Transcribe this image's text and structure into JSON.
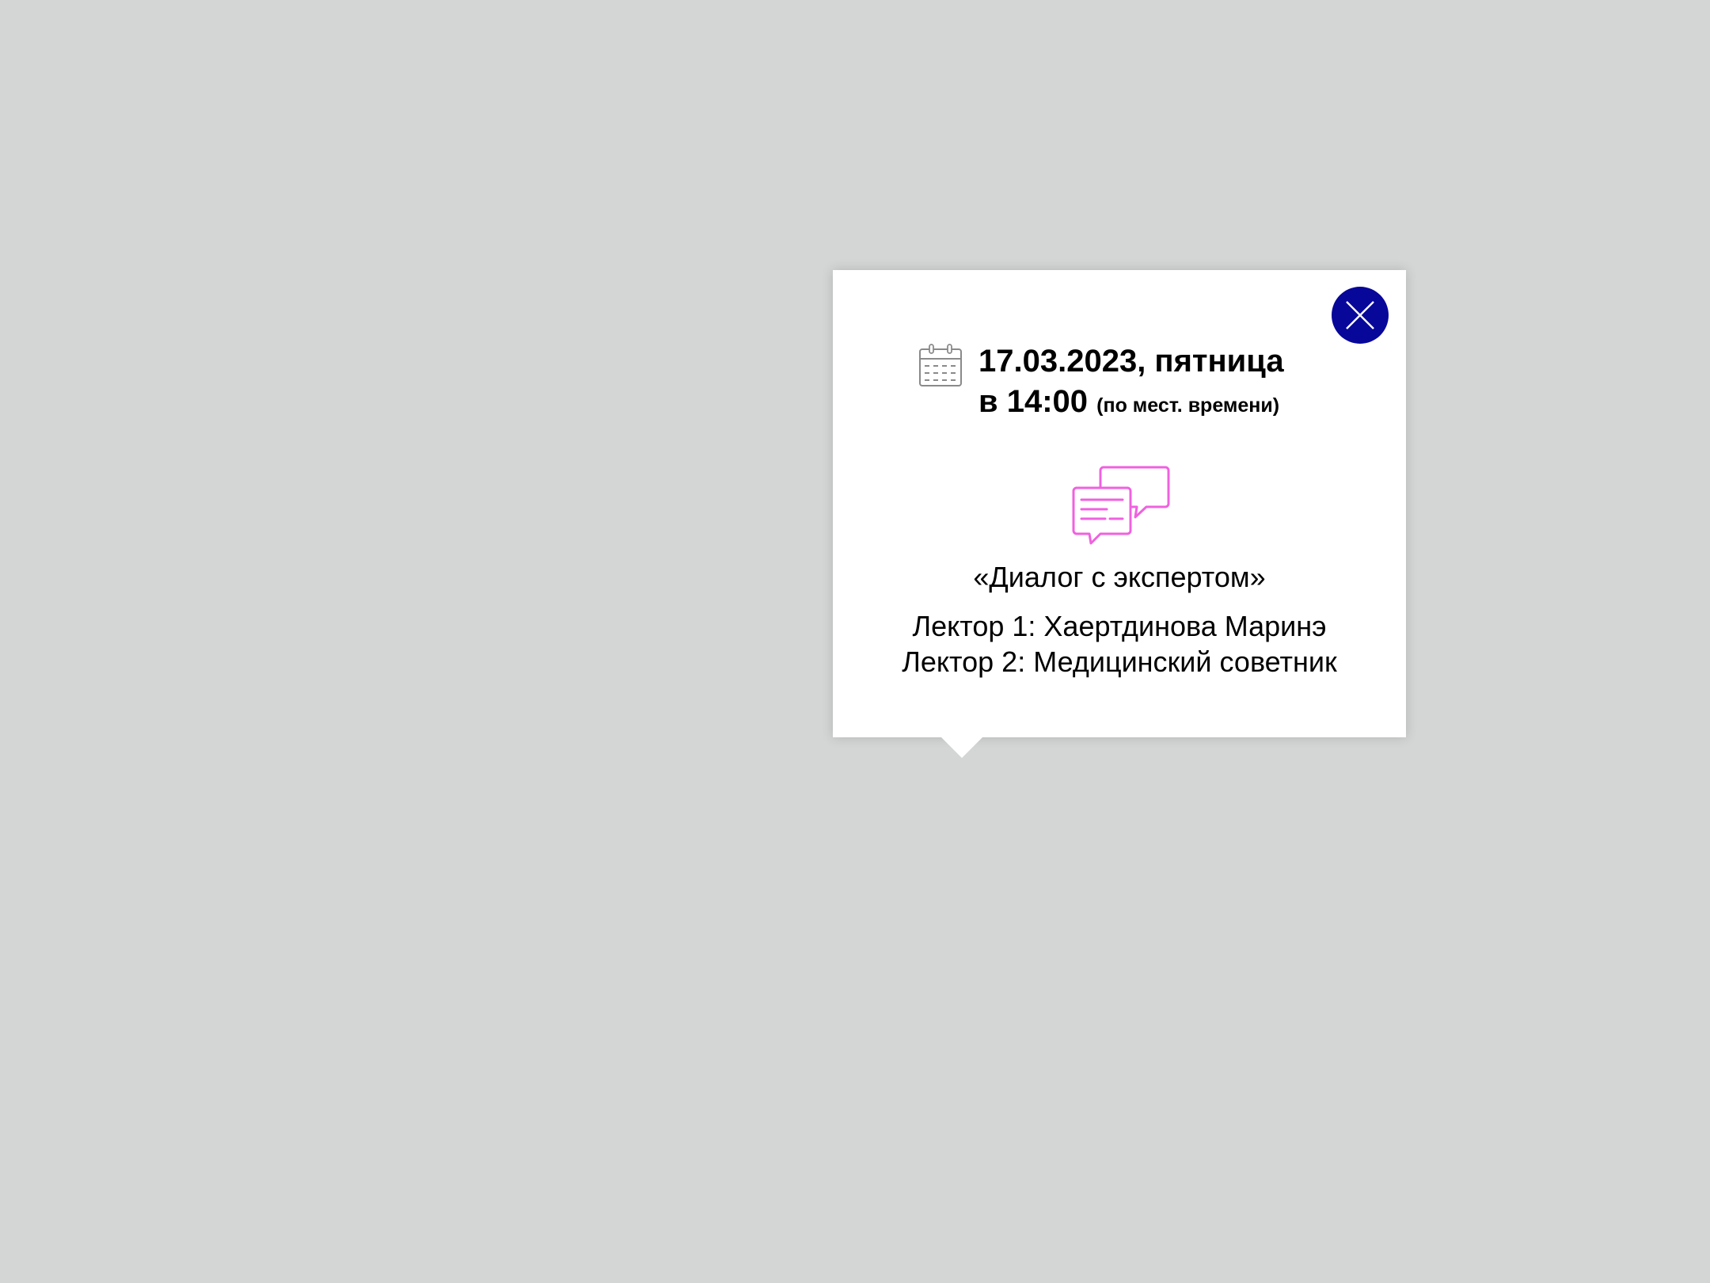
{
  "popup": {
    "date": "17.03.2023, пятница",
    "time": "в 14:00",
    "time_note": "(по мест. времени)",
    "icons": {
      "calendar": "calendar-icon",
      "event": "chat-bubbles-icon",
      "close": "close-icon"
    },
    "event_title": "«Диалог с экспертом»",
    "lecturers": [
      "Лектор 1: Хаертдинова Маринэ",
      "Лектор 2: Медицинский советник"
    ]
  },
  "colors": {
    "background": "#d4d6d6",
    "popup": "#ffffff",
    "close_button": "#07079a",
    "chat_icon": "#f061e0",
    "calendar_icon": "#8a8a8a"
  }
}
